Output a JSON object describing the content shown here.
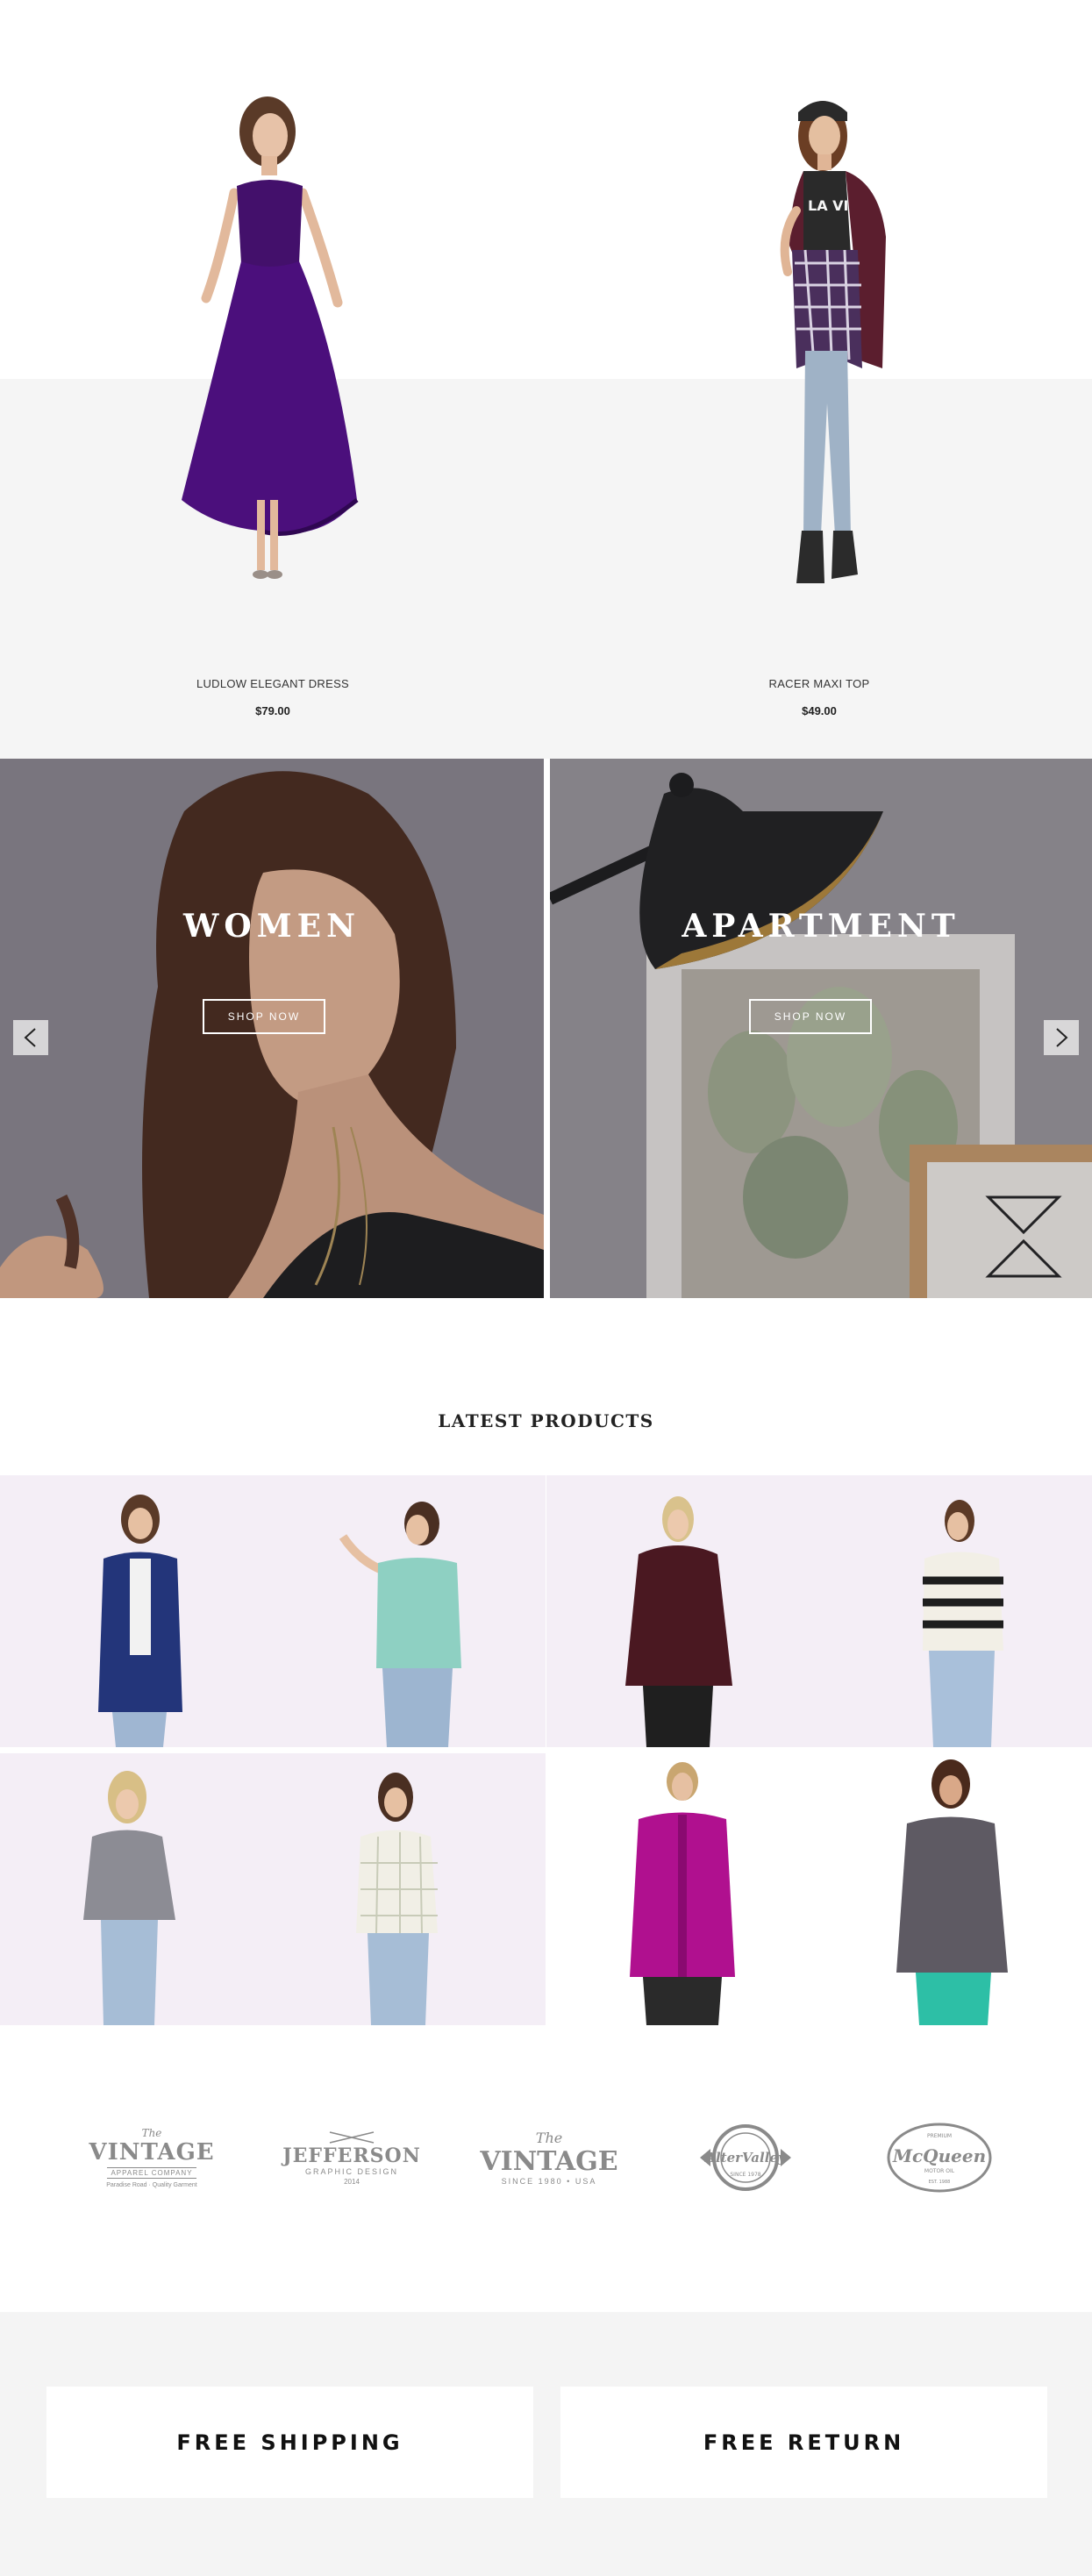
{
  "featured_products": [
    {
      "name": "LUDLOW ELEGANT DRESS",
      "price": "$79.00",
      "image_icon": "purple-dress-model"
    },
    {
      "name": "RACER MAXI TOP",
      "price": "$49.00",
      "image_icon": "racer-top-model"
    }
  ],
  "featured_product_print": "LA VIE",
  "banners": [
    {
      "title": "WOMEN",
      "cta": "SHOP NOW",
      "image_icon": "woman-portrait"
    },
    {
      "title": "APARTMENT",
      "cta": "SHOP NOW",
      "image_icon": "lamp-and-cactus-print"
    }
  ],
  "slider": {
    "prev_icon": "chevron-left-icon",
    "next_icon": "chevron-right-icon"
  },
  "latest_products": {
    "title": "LATEST PRODUCTS",
    "items": [
      {
        "image_icon": "navy-blazer-model"
      },
      {
        "image_icon": "mint-shirt-model"
      },
      {
        "image_icon": "burgundy-sweater-model"
      },
      {
        "image_icon": "striped-sweater-model"
      },
      {
        "image_icon": "grey-tee-model"
      },
      {
        "image_icon": "plaid-shirt-model"
      },
      {
        "image_icon": "magenta-jacket-model"
      },
      {
        "image_icon": "grey-pullover-model"
      }
    ]
  },
  "brands": [
    {
      "line1": "The",
      "line2": "VINTAGE",
      "line3": "APPAREL COMPANY",
      "line4": "Paradise Road · Quality Garment"
    },
    {
      "line1": "",
      "line2": "JEFFERSON",
      "line3": "GRAPHIC DESIGN",
      "line4": "2014"
    },
    {
      "line1": "The",
      "line2": "VINTAGE",
      "line3": "SINCE 1980 • USA",
      "line4": ""
    },
    {
      "line1": "",
      "line2": "AlterValley",
      "line3": "SINCE 1978",
      "line4": ""
    },
    {
      "line1": "PREMIUM",
      "line2": "McQueen",
      "line3": "MOTOR OIL",
      "line4": "EST. 1988"
    }
  ],
  "services": [
    {
      "label": "FREE SHIPPING"
    },
    {
      "label": "FREE RETURN"
    }
  ],
  "colors": {
    "grey_band": "#f5f5f5",
    "tile_lilac": "#f4eef6",
    "services_bg": "#f4f4f4",
    "logo_grey": "#8a8a8a"
  }
}
